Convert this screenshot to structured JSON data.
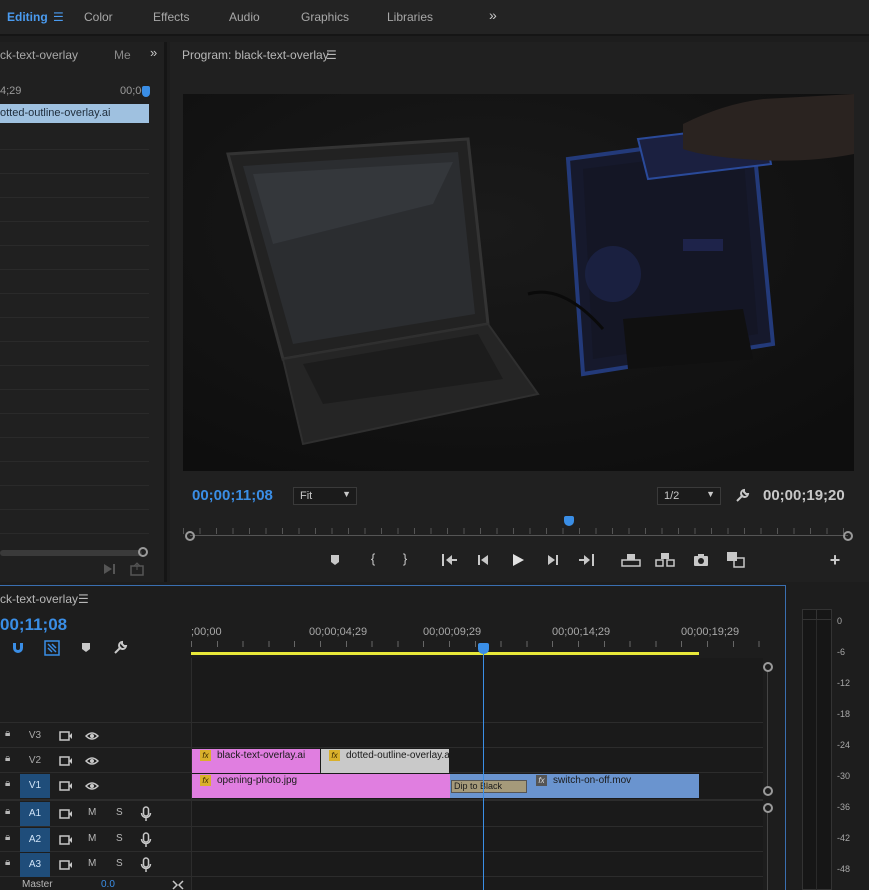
{
  "workspaces": {
    "tabs": [
      {
        "label": "Editing",
        "active": true
      },
      {
        "label": "Color"
      },
      {
        "label": "Effects"
      },
      {
        "label": "Audio"
      },
      {
        "label": "Graphics"
      },
      {
        "label": "Libraries"
      }
    ],
    "overflow": "»",
    "menu": "☰"
  },
  "source": {
    "title": "ck-text-overlay",
    "title2": "Me",
    "overflow": "»",
    "ruler_left": "4;29",
    "ruler_right": "00;00",
    "clip_name": "otted-outline-overlay.ai"
  },
  "program": {
    "title": "Program: black-text-overlay",
    "menu": "☰",
    "current_tc": "00;00;11;08",
    "zoom": "Fit",
    "resolution": "1/2",
    "duration_tc": "00;00;19;20",
    "playhead_fraction": 0.576
  },
  "timeline": {
    "title": "ck-text-overlay",
    "menu": "☰",
    "timecode": "00;11;08",
    "ruler": [
      ";00;00",
      "00;00;04;29",
      "00;00;09;29",
      "00;00;14;29",
      "00;00;19;29"
    ],
    "tracks": [
      {
        "label": "V3",
        "type": "video"
      },
      {
        "label": "V2",
        "type": "video"
      },
      {
        "label": "V1",
        "type": "video",
        "selected": true
      },
      {
        "label": "A1",
        "type": "audio",
        "selected": true
      },
      {
        "label": "A2",
        "type": "audio",
        "selected": true
      },
      {
        "label": "A3",
        "type": "audio",
        "selected": true
      }
    ],
    "audio_m": "M",
    "audio_s": "S",
    "master_label": "Master",
    "master_value": "0.0",
    "clips": {
      "v2_a": "black-text-overlay.ai",
      "v2_b": "dotted-outline-overlay.ai",
      "v1_a": "opening-photo.jpg",
      "transition": "Dip to Black",
      "v1_b": "switch-on-off.mov"
    },
    "fx_badge": "fx"
  },
  "meter": {
    "ticks": [
      "0",
      "-6",
      "-12",
      "-18",
      "-24",
      "-30",
      "-36",
      "-42",
      "-48"
    ]
  },
  "colors": {
    "accent": "#3a8ee6",
    "clip_pink": "#e07ee0",
    "clip_blue": "#6a94cf",
    "clip_gray": "#c9c9c9",
    "src_clip": "#9fc1e0",
    "work_area": "#e8e83a"
  },
  "icons": [
    "hamburger-icon",
    "chevron-right-double-icon",
    "marker-icon",
    "mark-in-icon",
    "mark-out-icon",
    "go-to-in-icon",
    "step-back-icon",
    "play-icon",
    "step-forward-icon",
    "go-to-out-icon",
    "lift-icon",
    "extract-icon",
    "camera-icon",
    "compare-icon",
    "plus-icon",
    "wrench-icon",
    "lock-icon",
    "toggle-output-icon",
    "eye-icon",
    "mic-icon",
    "snap-icon",
    "linked-selection-icon"
  ]
}
